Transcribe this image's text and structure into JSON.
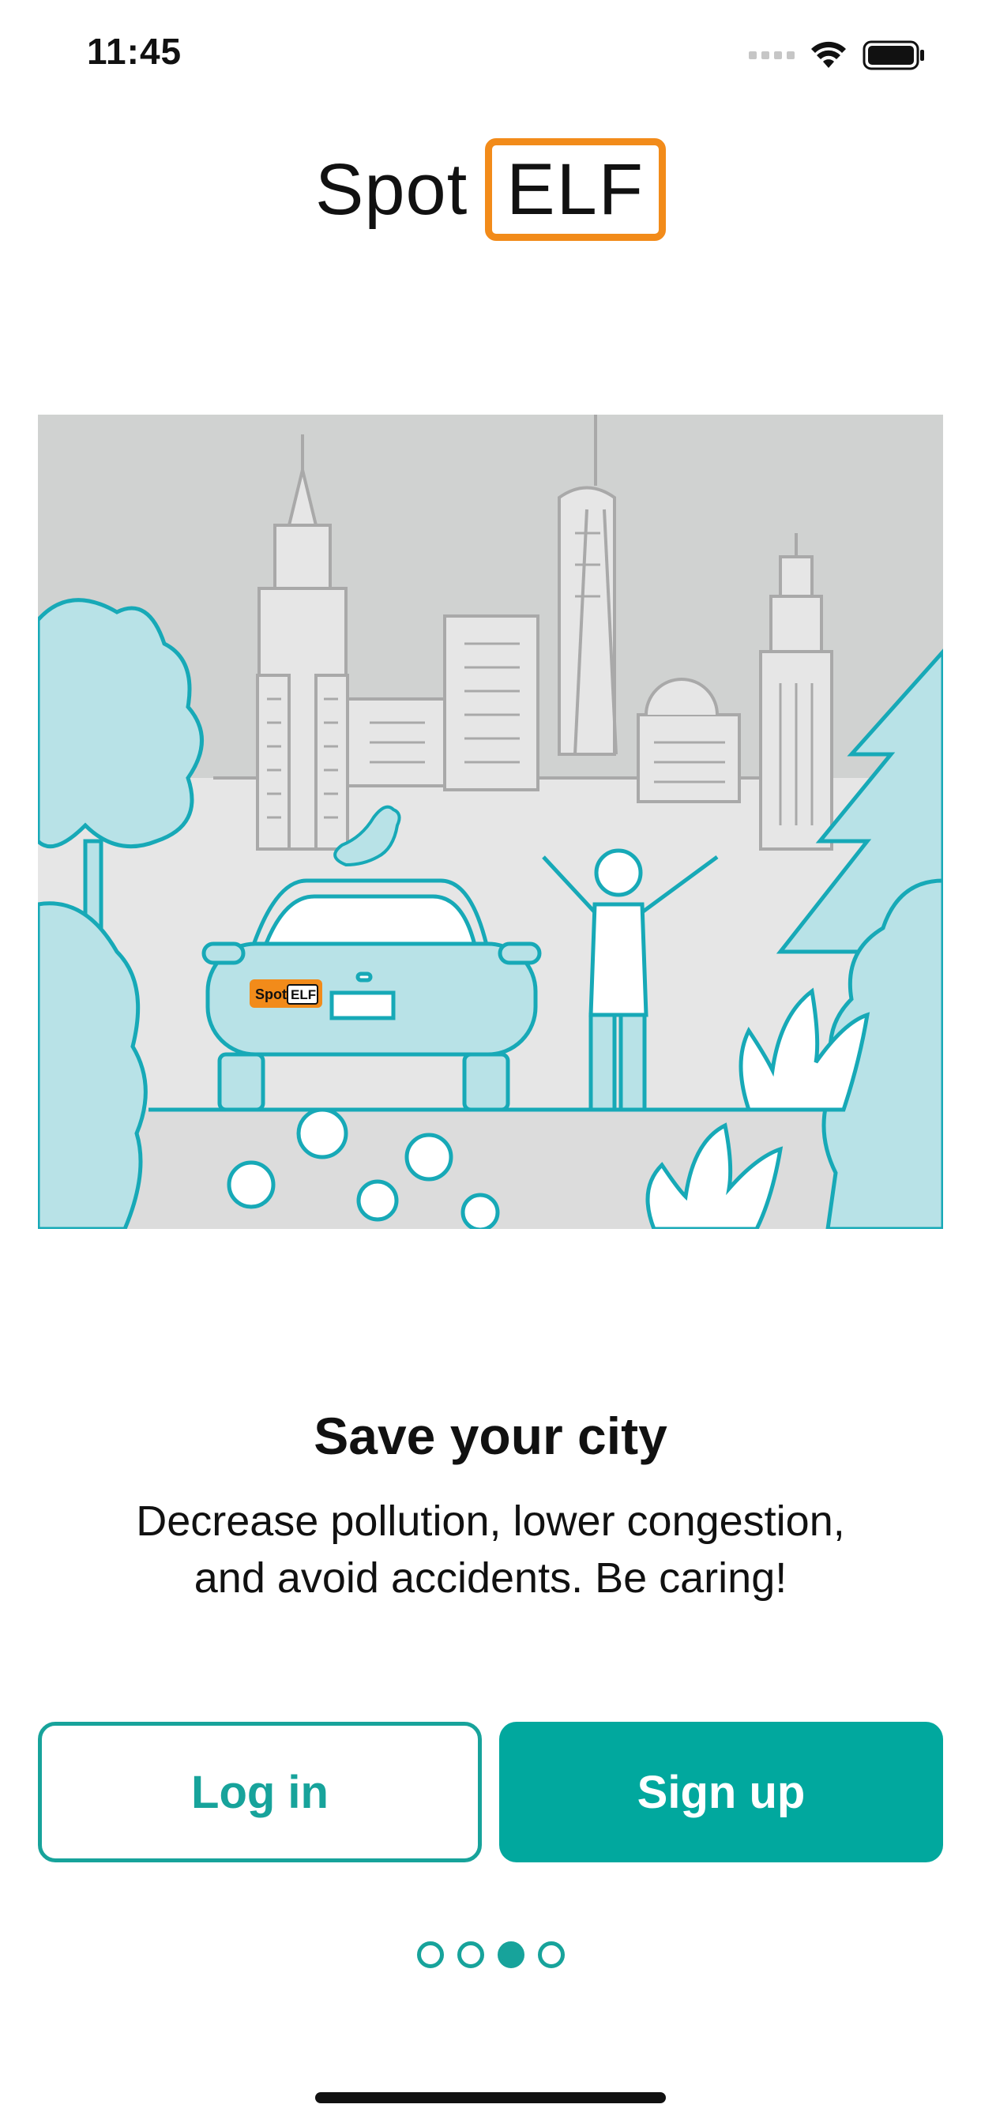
{
  "status_bar": {
    "time": "11:45"
  },
  "logo": {
    "word": "Spot",
    "boxed": "ELF"
  },
  "illustration": {
    "sticker_word": "Spot",
    "sticker_boxed": "ELF"
  },
  "onboarding": {
    "title": "Save your city",
    "description": "Decrease pollution, lower congestion, and avoid accidents. Be caring!"
  },
  "buttons": {
    "login": "Log in",
    "signup": "Sign up"
  },
  "pager": {
    "total": 4,
    "active_index": 2
  },
  "colors": {
    "accent": "#17a39b",
    "accent_fill": "#01a89e",
    "logo_orange": "#f28b1a",
    "foliage": "#b8e2e7"
  }
}
